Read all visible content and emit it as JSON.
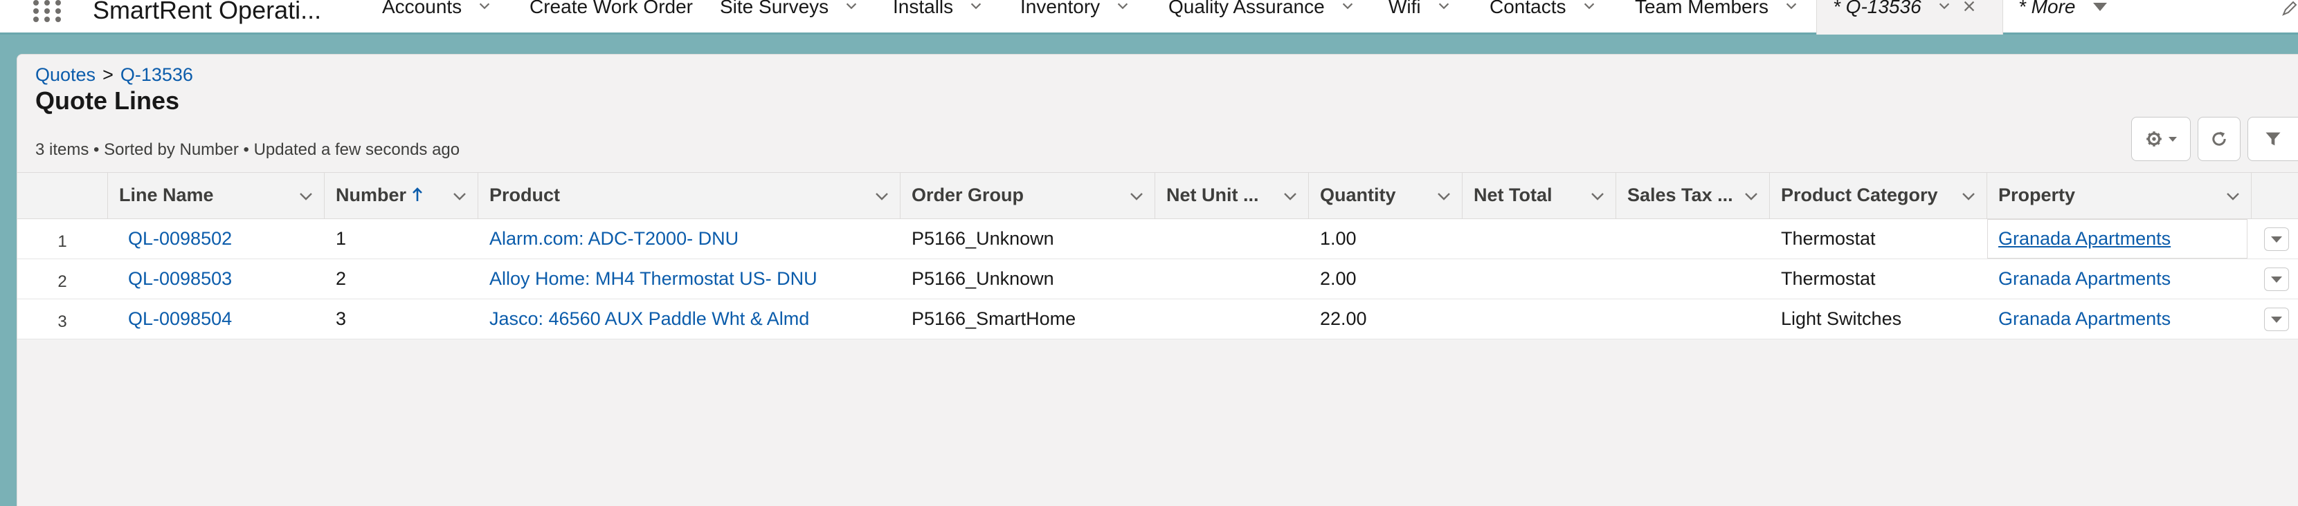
{
  "nav": {
    "app_name": "SmartRent Operati...",
    "items": [
      {
        "label": "Accounts",
        "has_menu": true
      },
      {
        "label": "Create Work Order",
        "has_menu": false
      },
      {
        "label": "Site Surveys",
        "has_menu": true
      },
      {
        "label": "Installs",
        "has_menu": true
      },
      {
        "label": "Inventory",
        "has_menu": true
      },
      {
        "label": "Quality Assurance",
        "has_menu": true
      },
      {
        "label": "Wifi",
        "has_menu": true
      },
      {
        "label": "Contacts",
        "has_menu": true
      },
      {
        "label": "Team Members",
        "has_menu": true
      }
    ],
    "active_tab": {
      "label": "* Q-13536"
    },
    "more": {
      "label": "* More"
    }
  },
  "breadcrumb": {
    "parent": "Quotes",
    "separator": ">",
    "current": "Q-13536"
  },
  "page": {
    "title": "Quote Lines",
    "list_info": "3 items • Sorted by Number • Updated a few seconds ago"
  },
  "table": {
    "columns": [
      {
        "label": "Line Name"
      },
      {
        "label": "Number",
        "sorted": "ascending"
      },
      {
        "label": "Product"
      },
      {
        "label": "Order Group"
      },
      {
        "label": "Net Unit ..."
      },
      {
        "label": "Quantity"
      },
      {
        "label": "Net Total"
      },
      {
        "label": "Sales Tax ..."
      },
      {
        "label": "Product Category"
      },
      {
        "label": "Property"
      }
    ],
    "rows": [
      {
        "row_number": "1",
        "line_name": "QL-0098502",
        "number": "1",
        "product": "Alarm.com: ADC-T2000- DNU",
        "order_group": "P5166_Unknown",
        "net_unit": "",
        "quantity": "1.00",
        "net_total": "",
        "sales_tax": "",
        "product_category": "Thermostat",
        "property": "Granada Apartments"
      },
      {
        "row_number": "2",
        "line_name": "QL-0098503",
        "number": "2",
        "product": "Alloy Home: MH4 Thermostat US- DNU",
        "order_group": "P5166_Unknown",
        "net_unit": "",
        "quantity": "2.00",
        "net_total": "",
        "sales_tax": "",
        "product_category": "Thermostat",
        "property": "Granada Apartments"
      },
      {
        "row_number": "3",
        "line_name": "QL-0098504",
        "number": "3",
        "product": "Jasco: 46560 AUX Paddle Wht & Almd",
        "order_group": "P5166_SmartHome",
        "net_unit": "",
        "quantity": "22.00",
        "net_total": "",
        "sales_tax": "",
        "product_category": "Light Switches",
        "property": "Granada Apartments"
      }
    ]
  },
  "colors": {
    "link": "#0b5cab",
    "teal_background": "#7ab1b6",
    "card_background": "#f3f2f2",
    "text": "#181818"
  },
  "icons": {
    "app_launcher": "waffle-grid-icon",
    "nav_chevron": "chevron-down-icon",
    "close_tab": "close-icon",
    "settings": "gear-icon",
    "refresh": "refresh-icon",
    "filter": "filter-icon",
    "sort": "arrow-up-icon",
    "row_action": "caret-down-icon",
    "edit": "pencil-icon"
  }
}
